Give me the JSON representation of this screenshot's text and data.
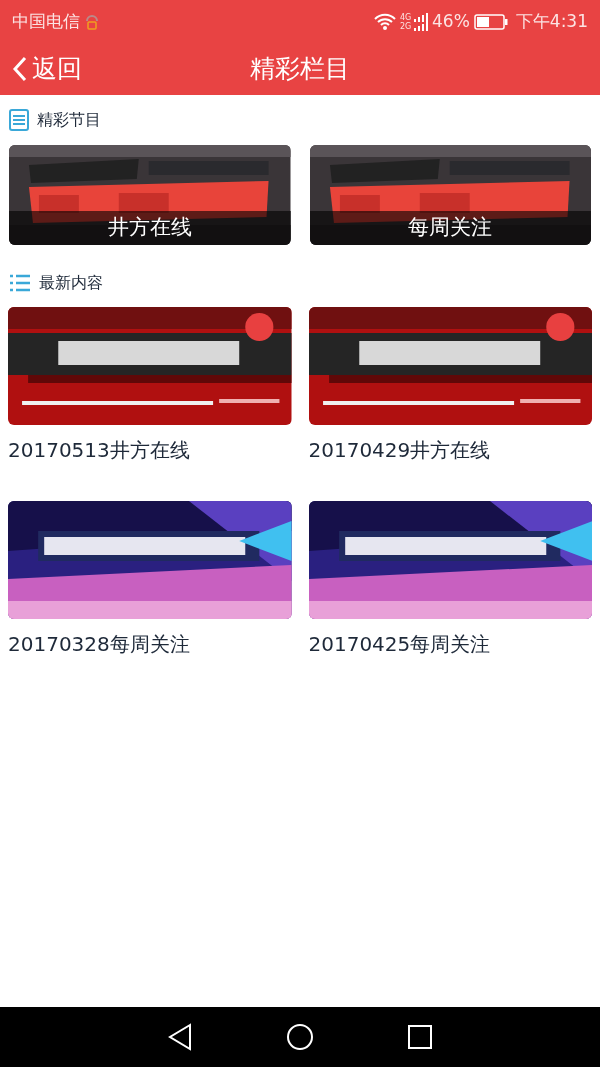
{
  "status_bar": {
    "carrier": "中国电信",
    "network": "4G 2G",
    "battery": "46%",
    "time": "下午4:31"
  },
  "nav_bar": {
    "back": "返回",
    "title": "精彩栏目"
  },
  "featured": {
    "heading": "精彩节目",
    "items": [
      {
        "caption": "井方在线"
      },
      {
        "caption": "每周关注"
      }
    ]
  },
  "latest": {
    "heading": "最新内容",
    "items": [
      {
        "title": "20170513井方在线"
      },
      {
        "title": "20170429井方在线"
      },
      {
        "title": "20170328每周关注"
      },
      {
        "title": "20170425每周关注"
      }
    ]
  }
}
